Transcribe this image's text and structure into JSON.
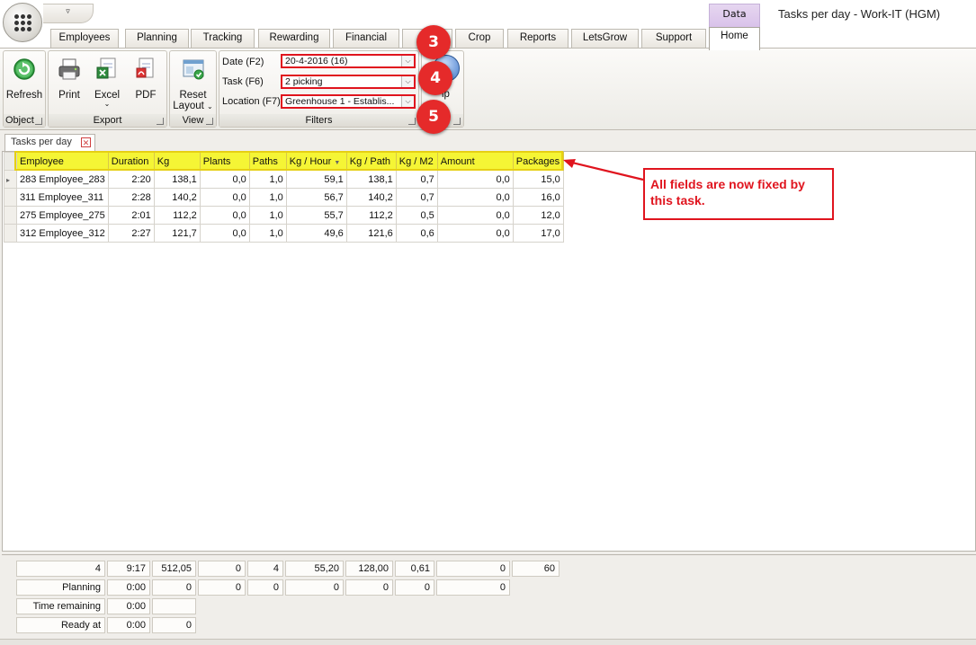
{
  "app": {
    "window_title": "Tasks per day - Work-IT (HGM)",
    "qat_glyph": "▿",
    "context_tab": "Data"
  },
  "tabs": [
    {
      "label": "Employees"
    },
    {
      "label": "Planning"
    },
    {
      "label": "Tracking"
    },
    {
      "label": "Rewarding"
    },
    {
      "label": "Financial"
    },
    {
      "label": ""
    },
    {
      "label": "Crop"
    },
    {
      "label": "Reports"
    },
    {
      "label": "LetsGrow"
    },
    {
      "label": "Support"
    },
    {
      "label": "Home"
    }
  ],
  "ribbon": {
    "object": {
      "label": "Object",
      "refresh": "Refresh"
    },
    "export": {
      "label": "Export",
      "print": "Print",
      "excel": "Excel",
      "pdf": "PDF"
    },
    "view": {
      "label": "View",
      "reset": "Reset",
      "layout": "Layout"
    },
    "filters": {
      "label": "Filters",
      "date_label": "Date (F2)",
      "date_value": "20-4-2016 (16)",
      "task_label": "Task (F6)",
      "task_value": "2 picking",
      "location_label": "Location (F7)",
      "location_value": "Greenhouse 1 - Establis..."
    },
    "help_partial": "lp"
  },
  "badges": [
    "3",
    "4",
    "5"
  ],
  "doc_tab": "Tasks per day",
  "grid": {
    "columns": [
      "Employee",
      "Duration",
      "Kg",
      "Plants",
      "Paths",
      "Kg / Hour",
      "Kg / Path",
      "Kg / M2",
      "Amount",
      "Packages"
    ],
    "sort_glyph": "▼",
    "row_indicator": "▸",
    "rows": [
      [
        "283 Employee_283",
        "2:20",
        "138,1",
        "0,0",
        "1,0",
        "59,1",
        "138,1",
        "0,7",
        "0,0",
        "15,0"
      ],
      [
        "311 Employee_311",
        "2:28",
        "140,2",
        "0,0",
        "1,0",
        "56,7",
        "140,2",
        "0,7",
        "0,0",
        "16,0"
      ],
      [
        "275 Employee_275",
        "2:01",
        "112,2",
        "0,0",
        "1,0",
        "55,7",
        "112,2",
        "0,5",
        "0,0",
        "12,0"
      ],
      [
        "312 Employee_312",
        "2:27",
        "121,7",
        "0,0",
        "1,0",
        "49,6",
        "121,6",
        "0,6",
        "0,0",
        "17,0"
      ]
    ]
  },
  "footer": {
    "totals": [
      "4",
      "9:17",
      "512,05",
      "0",
      "4",
      "55,20",
      "128,00",
      "0,61",
      "0",
      "60"
    ],
    "planning": [
      "Planning",
      "0:00",
      "0",
      "0",
      "0",
      "0",
      "0",
      "0",
      "0"
    ],
    "time_remaining": [
      "Time remaining",
      "0:00",
      ""
    ],
    "ready_at": [
      "Ready at",
      "0:00",
      "0"
    ]
  },
  "annotation": {
    "text": "All fields are now fixed by this task.",
    "color": "#e0141e"
  },
  "colors": {
    "header_fill": "#f5f535",
    "highlight_red": "#e0141e",
    "badge_red": "#e52a2a",
    "context_tab": "#d9c2ea"
  }
}
